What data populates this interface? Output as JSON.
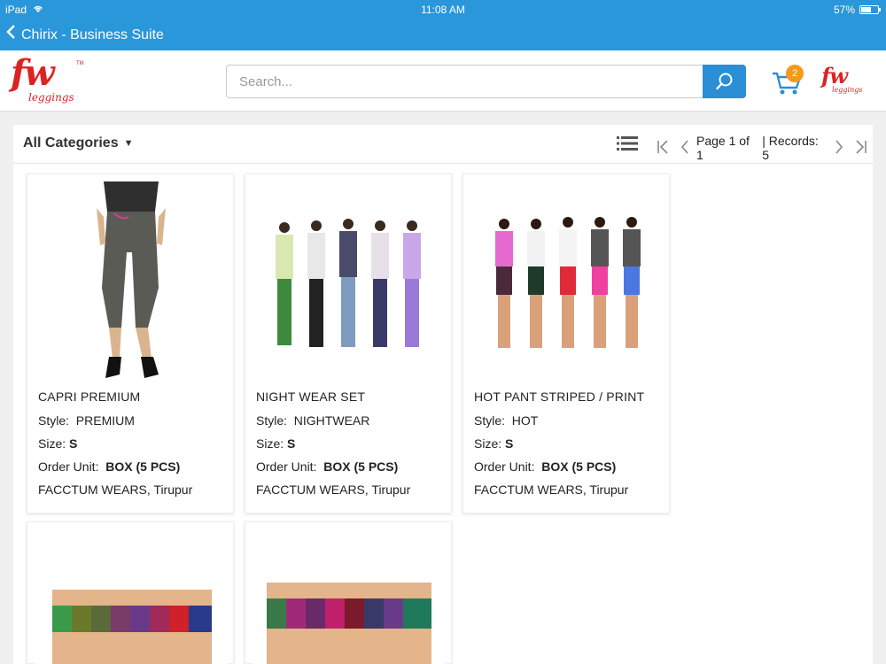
{
  "status_bar": {
    "device": "iPad",
    "time": "11:08 AM",
    "battery": "57%"
  },
  "nav": {
    "back_title": "Chirix - Business Suite"
  },
  "header": {
    "logo_text": "fw",
    "logo_sub": "leggings",
    "search_placeholder": "Search...",
    "cart_count": "2"
  },
  "toolbar": {
    "category": "All Categories",
    "page_info": "Page 1 of 1",
    "records": "| Records: 5"
  },
  "products": [
    {
      "name": "CAPRI PREMIUM",
      "style_label": "Style:",
      "style": "PREMIUM",
      "size_label": "Size:",
      "size": "S",
      "unit_label": "Order Unit:",
      "unit": "BOX (5 PCS)",
      "seller": "FACCTUM WEARS, Tirupur"
    },
    {
      "name": "NIGHT WEAR SET",
      "style_label": "Style:",
      "style": "NIGHTWEAR",
      "size_label": "Size:",
      "size": "S",
      "unit_label": "Order Unit:",
      "unit": "BOX (5 PCS)",
      "seller": "FACCTUM WEARS, Tirupur"
    },
    {
      "name": "HOT PANT STRIPED / PRINT",
      "style_label": "Style:",
      "style": "HOT",
      "size_label": "Size:",
      "size": "S",
      "unit_label": "Order Unit:",
      "unit": "BOX (5 PCS)",
      "seller": "FACCTUM WEARS, Tirupur"
    }
  ],
  "colors": {
    "primary": "#2a97db",
    "accent": "#f39a1e",
    "brand": "#d22222"
  }
}
